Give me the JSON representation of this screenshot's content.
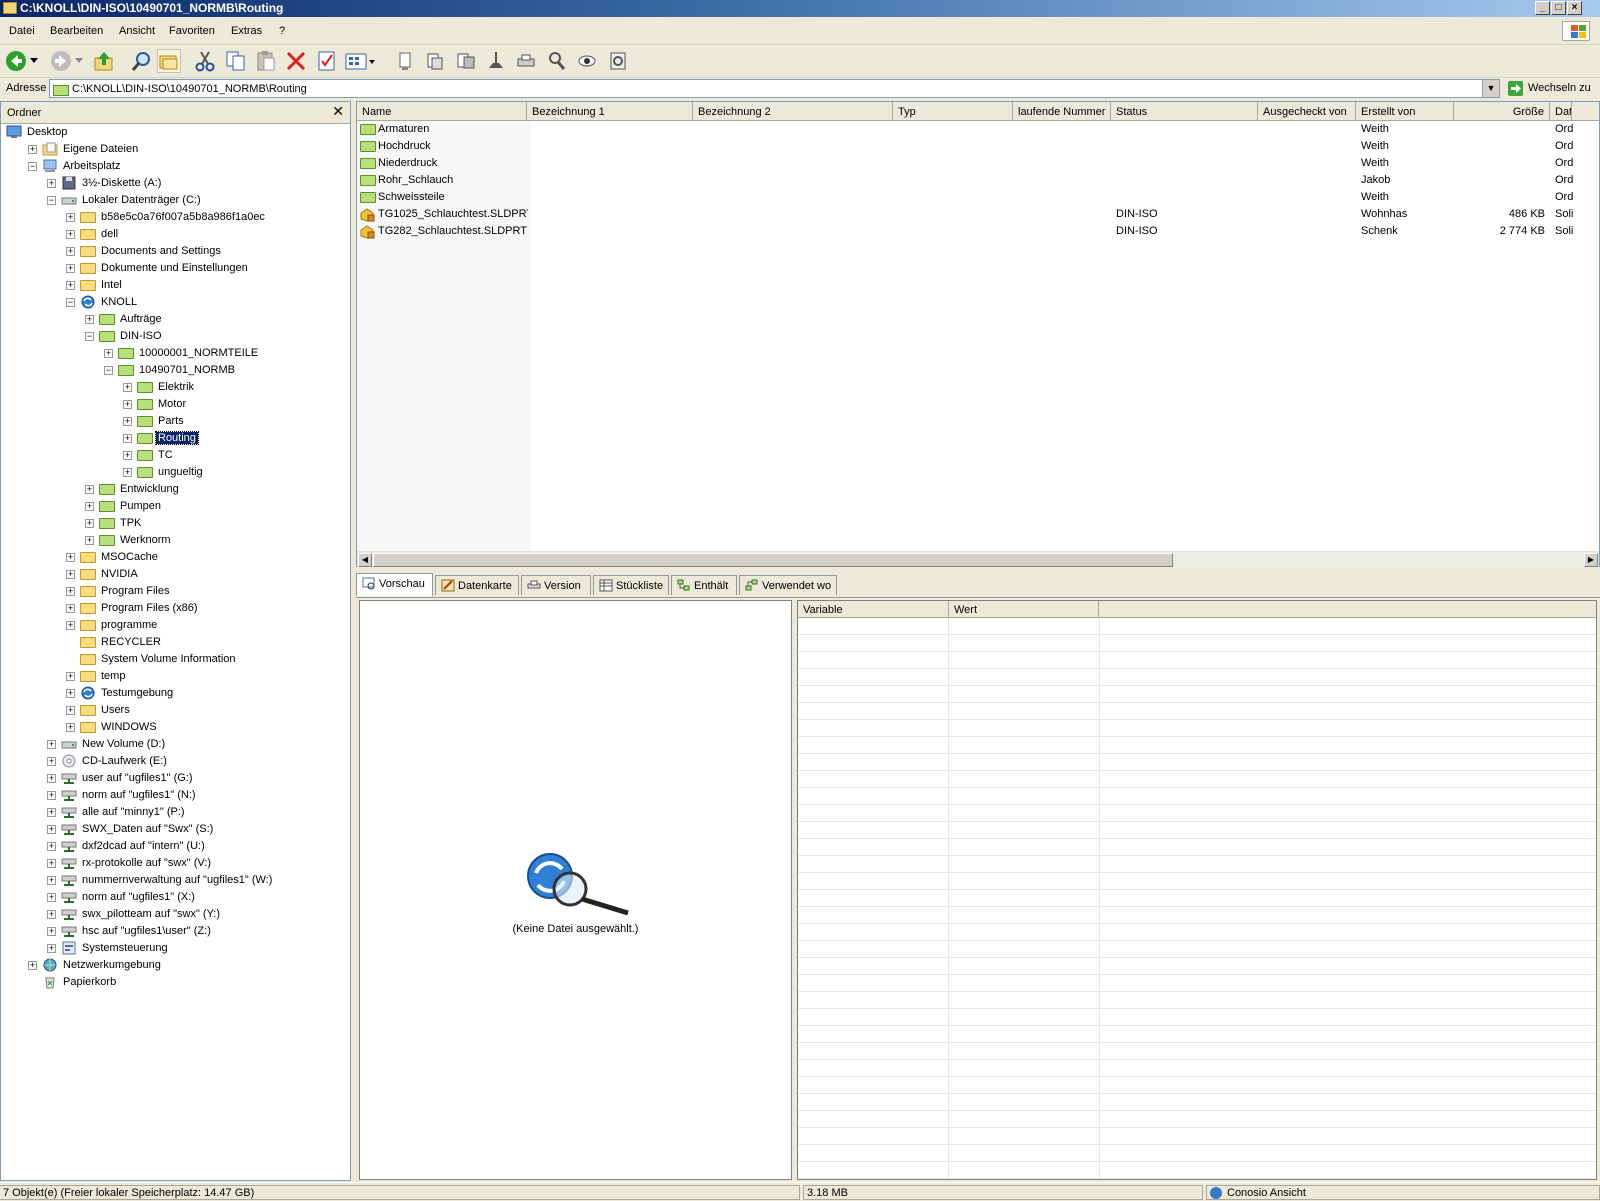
{
  "window": {
    "title": "C:\\KNOLL\\DIN-ISO\\10490701_NORMB\\Routing",
    "controls": [
      "_",
      "□",
      "×"
    ]
  },
  "menu": [
    "Datei",
    "Bearbeiten",
    "Ansicht",
    "Favoriten",
    "Extras",
    "?"
  ],
  "toolbar": {
    "buttons": [
      "back-icon",
      "dropdown-icon",
      "forward-icon",
      "dropdown-icon",
      "up-folder-icon",
      "search-icon",
      "folders-icon",
      "cut-icon",
      "copy-icon",
      "paste-icon",
      "delete-icon",
      "properties-icon",
      "views-icon",
      "document-icon",
      "checkout-icon",
      "checkin-icon",
      "undo-checkout-icon",
      "get-icon",
      "find-icon",
      "view-icon",
      "refresh-icon"
    ]
  },
  "address": {
    "label": "Adresse",
    "value": "C:\\KNOLL\\DIN-ISO\\10490701_NORMB\\Routing",
    "go_label": "Wechseln zu"
  },
  "tree": {
    "header": "Ordner",
    "close": "✕",
    "nodes": [
      {
        "label": "Desktop",
        "level": 0,
        "exp": "",
        "icon": "desktop"
      },
      {
        "label": "Eigene Dateien",
        "level": 1,
        "exp": "+",
        "icon": "mydocs"
      },
      {
        "label": "Arbeitsplatz",
        "level": 1,
        "exp": "-",
        "icon": "computer"
      },
      {
        "label": "3½-Diskette (A:)",
        "level": 2,
        "exp": "+",
        "icon": "floppy"
      },
      {
        "label": "Lokaler Datenträger (C:)",
        "level": 2,
        "exp": "-",
        "icon": "drive"
      },
      {
        "label": "b58e5c0a76f007a5b8a986f1a0ec",
        "level": 3,
        "exp": "+",
        "icon": "folder"
      },
      {
        "label": "dell",
        "level": 3,
        "exp": "+",
        "icon": "folder"
      },
      {
        "label": "Documents and Settings",
        "level": 3,
        "exp": "+",
        "icon": "folder"
      },
      {
        "label": "Dokumente und Einstellungen",
        "level": 3,
        "exp": "+",
        "icon": "folder"
      },
      {
        "label": "Intel",
        "level": 3,
        "exp": "+",
        "icon": "folder"
      },
      {
        "label": "KNOLL",
        "level": 3,
        "exp": "-",
        "icon": "vault"
      },
      {
        "label": "Aufträge",
        "level": 4,
        "exp": "+",
        "icon": "vfolder"
      },
      {
        "label": "DIN-ISO",
        "level": 4,
        "exp": "-",
        "icon": "vfolder"
      },
      {
        "label": "10000001_NORMTEILE",
        "level": 5,
        "exp": "+",
        "icon": "vfolder"
      },
      {
        "label": "10490701_NORMB",
        "level": 5,
        "exp": "-",
        "icon": "vfolder"
      },
      {
        "label": "Elektrik",
        "level": 6,
        "exp": "+",
        "icon": "vfolder"
      },
      {
        "label": "Motor",
        "level": 6,
        "exp": "+",
        "icon": "vfolder"
      },
      {
        "label": "Parts",
        "level": 6,
        "exp": "+",
        "icon": "vfolder"
      },
      {
        "label": "Routing",
        "level": 6,
        "exp": "+",
        "icon": "vfolder",
        "selected": true
      },
      {
        "label": "TC",
        "level": 6,
        "exp": "+",
        "icon": "vfolder"
      },
      {
        "label": "ungueltig",
        "level": 6,
        "exp": "+",
        "icon": "vfolder"
      },
      {
        "label": "Entwicklung",
        "level": 4,
        "exp": "+",
        "icon": "vfolder"
      },
      {
        "label": "Pumpen",
        "level": 4,
        "exp": "+",
        "icon": "vfolder"
      },
      {
        "label": "TPK",
        "level": 4,
        "exp": "+",
        "icon": "vfolder"
      },
      {
        "label": "Werknorm",
        "level": 4,
        "exp": "+",
        "icon": "vfolder"
      },
      {
        "label": "MSOCache",
        "level": 3,
        "exp": "+",
        "icon": "folder"
      },
      {
        "label": "NVIDIA",
        "level": 3,
        "exp": "+",
        "icon": "folder"
      },
      {
        "label": "Program Files",
        "level": 3,
        "exp": "+",
        "icon": "folder"
      },
      {
        "label": "Program Files (x86)",
        "level": 3,
        "exp": "+",
        "icon": "folder"
      },
      {
        "label": "programme",
        "level": 3,
        "exp": "+",
        "icon": "folder"
      },
      {
        "label": "RECYCLER",
        "level": 3,
        "exp": "",
        "icon": "folder"
      },
      {
        "label": "System Volume Information",
        "level": 3,
        "exp": "",
        "icon": "folder"
      },
      {
        "label": "temp",
        "level": 3,
        "exp": "+",
        "icon": "folder"
      },
      {
        "label": "Testumgebung",
        "level": 3,
        "exp": "+",
        "icon": "vault"
      },
      {
        "label": "Users",
        "level": 3,
        "exp": "+",
        "icon": "folder"
      },
      {
        "label": "WINDOWS",
        "level": 3,
        "exp": "+",
        "icon": "folder"
      },
      {
        "label": "New Volume (D:)",
        "level": 2,
        "exp": "+",
        "icon": "drive"
      },
      {
        "label": "CD-Laufwerk (E:)",
        "level": 2,
        "exp": "+",
        "icon": "cdrom"
      },
      {
        "label": "user auf \"ugfiles1\" (G:)",
        "level": 2,
        "exp": "+",
        "icon": "netdrive"
      },
      {
        "label": "norm auf \"ugfiles1\" (N:)",
        "level": 2,
        "exp": "+",
        "icon": "netdrive"
      },
      {
        "label": "alle auf \"minny1\" (P:)",
        "level": 2,
        "exp": "+",
        "icon": "netdrive"
      },
      {
        "label": "SWX_Daten auf \"Swx\" (S:)",
        "level": 2,
        "exp": "+",
        "icon": "netdrive"
      },
      {
        "label": "dxf2dcad auf \"intern\" (U:)",
        "level": 2,
        "exp": "+",
        "icon": "netdrive"
      },
      {
        "label": "rx-protokolle auf \"swx\" (V:)",
        "level": 2,
        "exp": "+",
        "icon": "netdrive"
      },
      {
        "label": "nummernverwaltung auf \"ugfiles1\" (W:)",
        "level": 2,
        "exp": "+",
        "icon": "netdrive"
      },
      {
        "label": "norm auf \"ugfiles1\" (X:)",
        "level": 2,
        "exp": "+",
        "icon": "netdrive"
      },
      {
        "label": "swx_pilotteam auf \"swx\" (Y:)",
        "level": 2,
        "exp": "+",
        "icon": "netdrive"
      },
      {
        "label": "hsc auf \"ugfiles1\\user\" (Z:)",
        "level": 2,
        "exp": "+",
        "icon": "netdrive"
      },
      {
        "label": "Systemsteuerung",
        "level": 2,
        "exp": "+",
        "icon": "control"
      },
      {
        "label": "Netzwerkumgebung",
        "level": 1,
        "exp": "+",
        "icon": "network"
      },
      {
        "label": "Papierkorb",
        "level": 1,
        "exp": "",
        "icon": "recycle"
      }
    ]
  },
  "list": {
    "columns": [
      "Name",
      "Bezeichnung 1",
      "Bezeichnung 2",
      "Typ",
      "laufende Nummer",
      "Status",
      "Ausgecheckt von",
      "Erstellt von",
      "Größe",
      "Dat"
    ],
    "rows": [
      {
        "name": "Armaturen",
        "icon": "vfolder",
        "status": "",
        "creator": "Weith",
        "size": "",
        "date": "Ord"
      },
      {
        "name": "Hochdruck",
        "icon": "vfolder",
        "status": "",
        "creator": "Weith",
        "size": "",
        "date": "Ord"
      },
      {
        "name": "Niederdruck",
        "icon": "vfolder",
        "status": "",
        "creator": "Weith",
        "size": "",
        "date": "Ord"
      },
      {
        "name": "Rohr_Schlauch",
        "icon": "vfolder",
        "status": "",
        "creator": "Jakob",
        "size": "",
        "date": "Ord"
      },
      {
        "name": "Schweissteile",
        "icon": "vfolder",
        "status": "",
        "creator": "Weith",
        "size": "",
        "date": "Ord"
      },
      {
        "name": "TG1025_Schlauchtest.SLDPRT",
        "icon": "part",
        "status": "DIN-ISO",
        "creator": "Wohnhas",
        "size": "486 KB",
        "date": "Soli"
      },
      {
        "name": "TG282_Schlauchtest.SLDPRT",
        "icon": "part",
        "status": "DIN-ISO",
        "creator": "Schenk",
        "size": "2 774 KB",
        "date": "Soli"
      }
    ]
  },
  "tabs": [
    {
      "label": "Vorschau",
      "icon": "preview-icon",
      "active": true
    },
    {
      "label": "Datenkarte",
      "icon": "datacard-icon"
    },
    {
      "label": "Version",
      "icon": "version-icon"
    },
    {
      "label": "Stückliste",
      "icon": "bom-icon"
    },
    {
      "label": "Enthält",
      "icon": "contains-icon"
    },
    {
      "label": "Verwendet wo",
      "icon": "where-used-icon"
    }
  ],
  "preview": {
    "text": "(Keine Datei ausgewählt.)"
  },
  "variables": {
    "columns": [
      "Variable",
      "Wert"
    ]
  },
  "status": {
    "objects": "7 Objekt(e)  (Freier lokaler Speicherplatz: 14.47 GB)",
    "size": "3.18 MB",
    "view": "Conosio Ansicht"
  },
  "colors": {
    "title_start": "#0a246a",
    "title_end": "#a6caf0",
    "selection": "#0a246a",
    "folder": "#f8dc7e",
    "vault_folder": "#b8e07a"
  }
}
